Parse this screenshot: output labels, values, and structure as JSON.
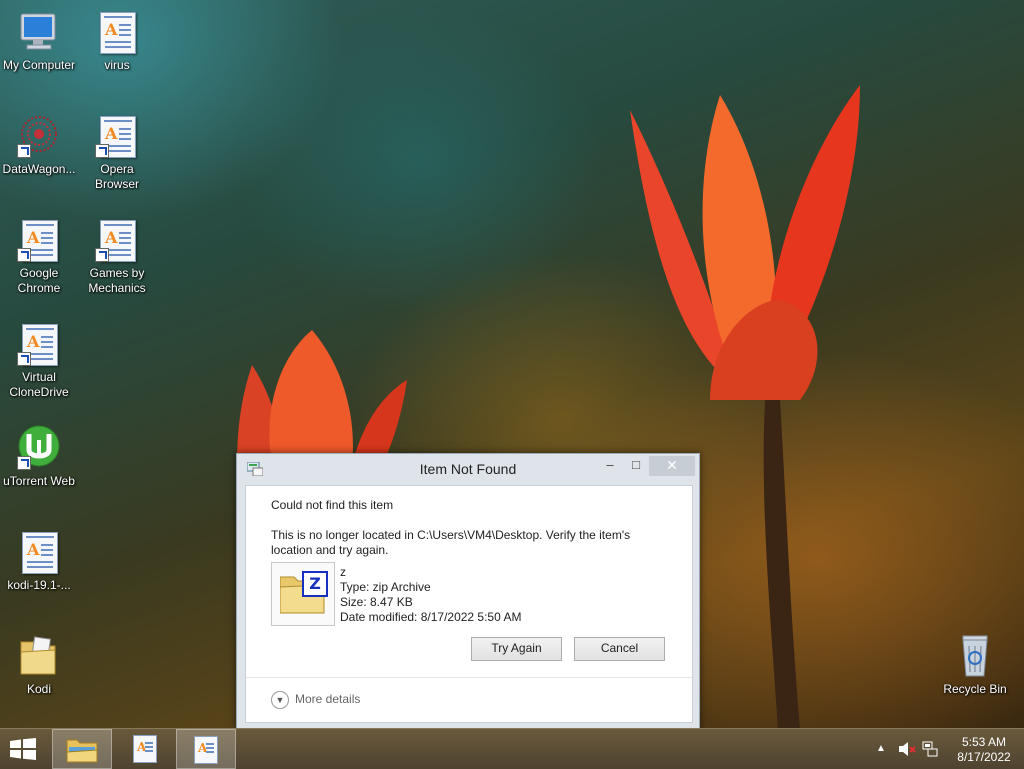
{
  "desktop": {
    "icons": [
      {
        "label": "My Computer"
      },
      {
        "label": "virus"
      },
      {
        "label": "DataWagon..."
      },
      {
        "label": "Opera Browser"
      },
      {
        "label": "Google Chrome"
      },
      {
        "label": "Games by Mechanics"
      },
      {
        "label": "Virtual CloneDrive"
      },
      {
        "label": "uTorrent Web"
      },
      {
        "label": "kodi-19.1-..."
      },
      {
        "label": "Kodi"
      },
      {
        "label": "Recycle Bin"
      }
    ]
  },
  "dialog": {
    "title": "Item Not Found",
    "heading": "Could not find this item",
    "message": "This is no longer located in C:\\Users\\VM4\\Desktop. Verify the item's location and try again.",
    "file": {
      "name": "z",
      "type": "Type: zip Archive",
      "size": "Size: 8.47 KB",
      "modified": "Date modified: 8/17/2022 5:50 AM"
    },
    "badge": "Z",
    "try_again_label": "Try Again",
    "cancel_label": "Cancel",
    "more_details_label": "More details",
    "minimize_glyph": "–",
    "maximize_glyph": "□",
    "close_glyph": "✕"
  },
  "taskbar": {
    "apps": [
      "file-explorer",
      "wordpad",
      "wordpad"
    ],
    "tray_up_glyph": "▲"
  },
  "clock": {
    "time": "5:53 AM",
    "date": "8/17/2022"
  },
  "colors": {
    "close_button": "#c7cdd5",
    "active_taskbar": "#ffffff38"
  }
}
